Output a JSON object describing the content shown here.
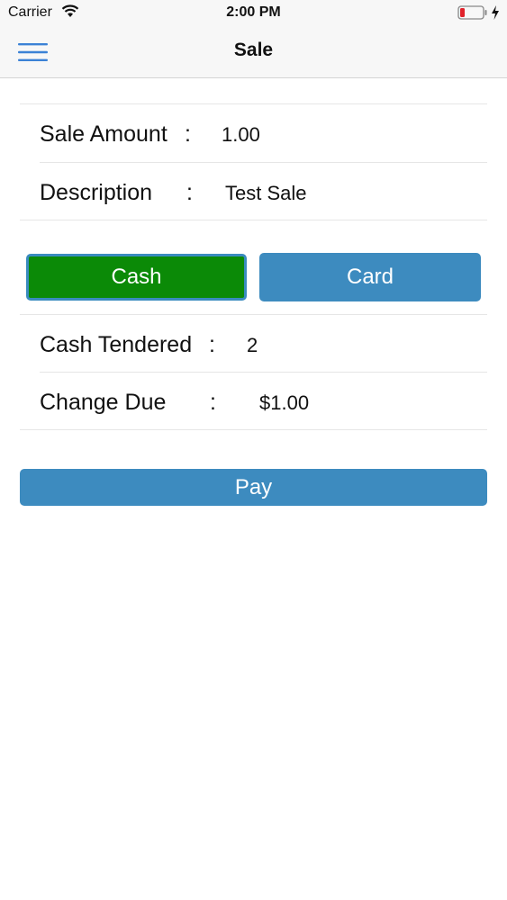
{
  "status_bar": {
    "carrier": "Carrier",
    "time": "2:00 PM"
  },
  "nav": {
    "title": "Sale"
  },
  "sale_details": {
    "sale_amount_label": "Sale Amount",
    "sale_amount_value": "1.00",
    "description_label": "Description",
    "description_value": "Test Sale",
    "colon": ":"
  },
  "payment_type": {
    "cash_label": "Cash",
    "card_label": "Card",
    "selected": "Cash"
  },
  "cash_details": {
    "cash_tendered_label": "Cash Tendered",
    "cash_tendered_value": "2",
    "change_due_label": "Change Due",
    "change_due_value": "$1.00"
  },
  "actions": {
    "pay_label": "Pay"
  },
  "colors": {
    "accent_blue": "#3d8bbf",
    "cash_selected_green": "#0b8a07",
    "menu_icon_blue": "#3b82d6"
  },
  "icons": {
    "menu": "hamburger-menu-icon",
    "wifi": "wifi-icon",
    "battery": "battery-low-icon",
    "charging": "charging-bolt-icon"
  }
}
